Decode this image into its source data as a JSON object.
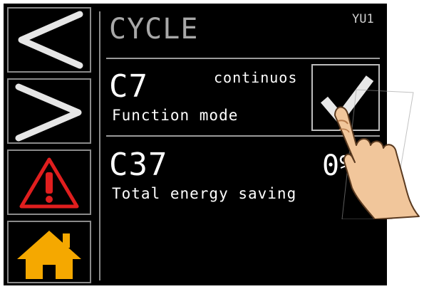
{
  "header": {
    "title": "CYCLE",
    "model": "YU1"
  },
  "sidebar": {
    "prev_icon": "chevron-left-icon",
    "next_icon": "chevron-right-icon",
    "alarm_icon": "warning-icon",
    "home_icon": "home-icon"
  },
  "params": [
    {
      "code": "C7",
      "label": "Function mode",
      "value": "continuos",
      "checked": true
    },
    {
      "code": "C37",
      "label": "Total energy saving",
      "value": "0%"
    }
  ],
  "colors": {
    "background": "#000000",
    "alarm": "#e01e1e",
    "home": "#f5a800",
    "text": "#ffffff",
    "title": "#a8a8a8"
  }
}
